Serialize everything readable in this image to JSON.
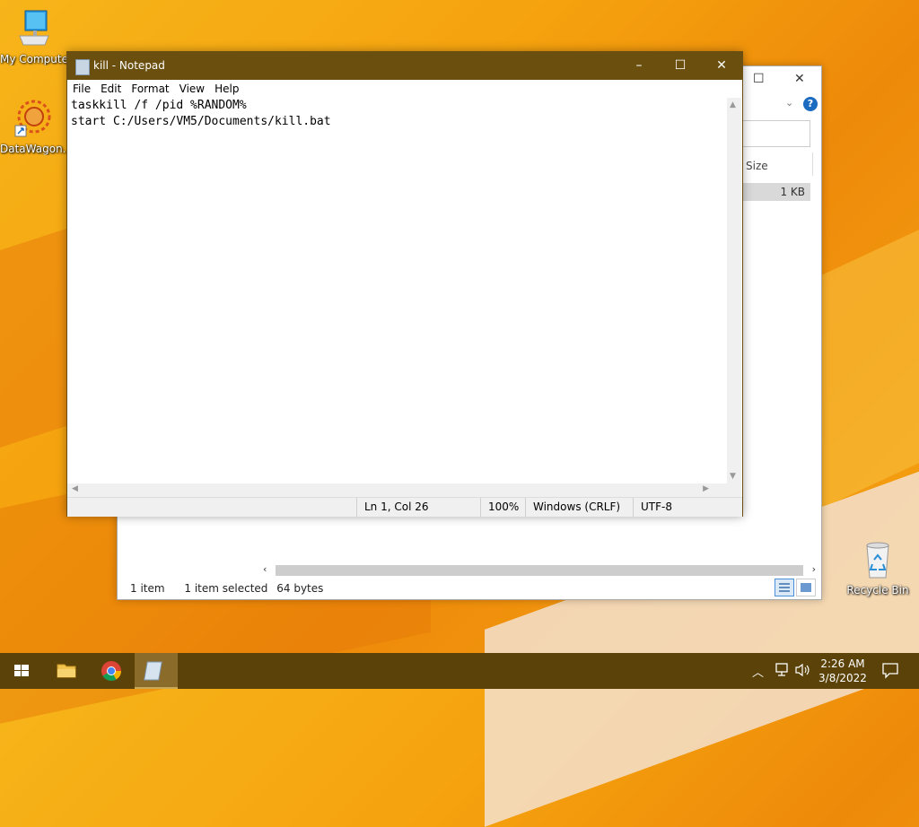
{
  "desktop": {
    "icons": [
      {
        "label": "My Computer"
      },
      {
        "label": "DataWagon..."
      },
      {
        "label": "Recycle Bin"
      }
    ]
  },
  "explorer": {
    "column_size": "Size",
    "file_size": "1 KB",
    "status_items": "1 item",
    "status_selected": "1 item selected",
    "status_bytes": "64 bytes",
    "help_glyph": "?"
  },
  "notepad": {
    "title": "kill - Notepad",
    "menu": [
      "File",
      "Edit",
      "Format",
      "View",
      "Help"
    ],
    "content": "taskkill /f /pid %RANDOM%\nstart C:/Users/VM5/Documents/kill.bat",
    "status": {
      "position": "Ln 1, Col 26",
      "zoom": "100%",
      "line_ending": "Windows (CRLF)",
      "encoding": "UTF-8"
    }
  },
  "taskbar": {
    "time": "2:26 AM",
    "date": "3/8/2022"
  },
  "colors": {
    "title_bar": "#6b4f0f",
    "taskbar": "#5b4208",
    "help_blue": "#1b6bc1"
  }
}
